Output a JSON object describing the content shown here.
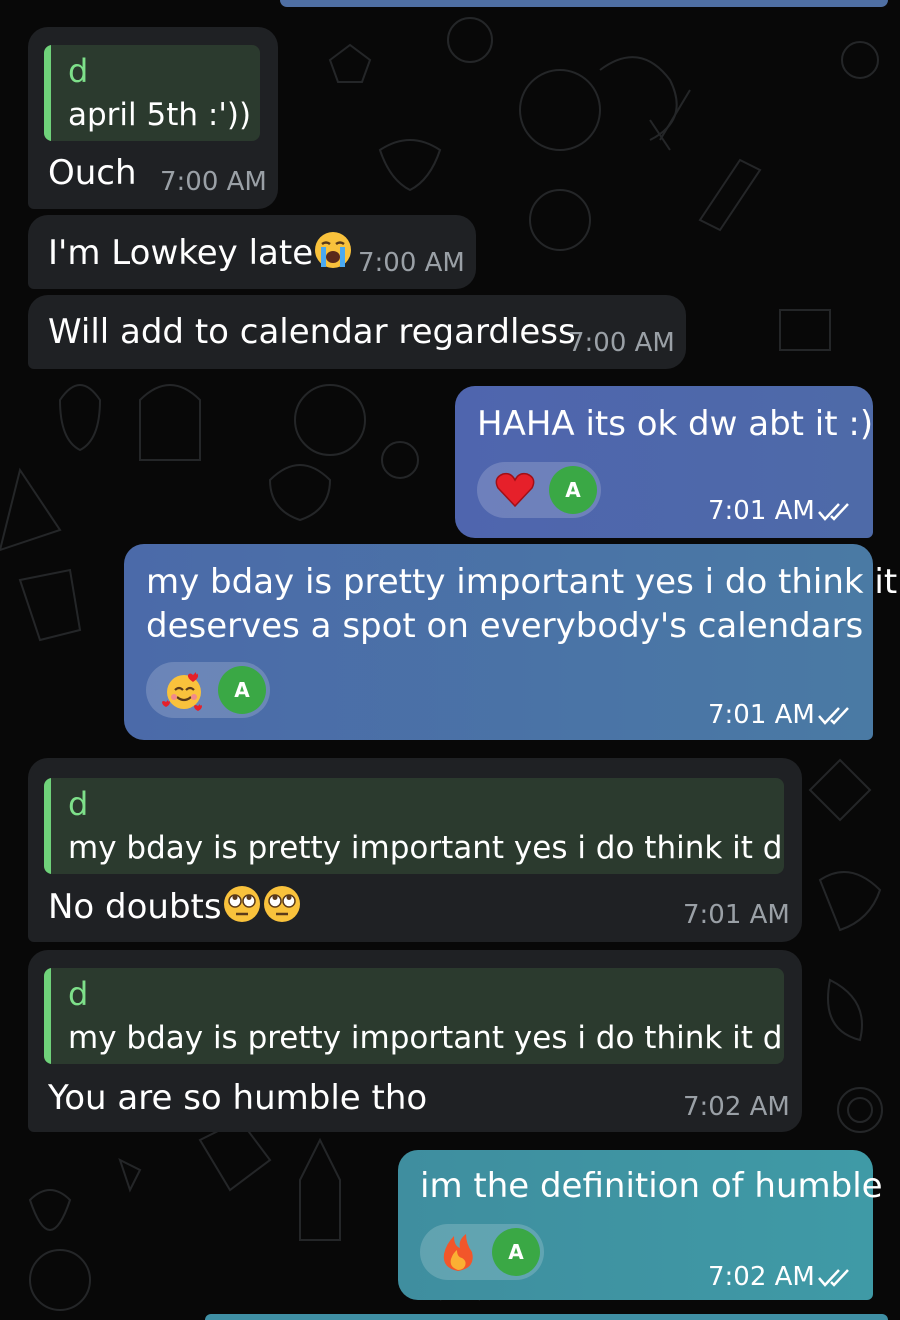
{
  "messages": [
    {
      "reply_author": "d",
      "reply_text": "april 5th :'))",
      "text": "Ouch",
      "time": "7:00 AM"
    },
    {
      "text": "I'm Lowkey late",
      "emoji": "loudly-crying-face",
      "time": "7:00 AM"
    },
    {
      "text": "Will add to calendar regardless",
      "time": "7:00 AM"
    },
    {
      "text": "HAHA its ok dw abt it :)",
      "reaction": "red-heart",
      "reaction_avatar": "A",
      "time": "7:01 AM"
    },
    {
      "line1": "my bday is pretty important yes i do think it",
      "line2": "deserves a spot on everybody's calendars",
      "reaction": "smiling-face-with-hearts",
      "reaction_avatar": "A",
      "time": "7:01 AM"
    },
    {
      "reply_author": "d",
      "reply_text": "my bday is pretty important yes i do think it de...",
      "text": "No doubts",
      "emoji": "face-with-rolling-eyes",
      "time": "7:01 AM"
    },
    {
      "reply_author": "d",
      "reply_text": "my bday is pretty important yes i do think it de...",
      "text": "You are so humble tho",
      "time": "7:02 AM"
    },
    {
      "text": "im the definition of humble",
      "reaction": "fire",
      "reaction_avatar": "A",
      "time": "7:02 AM"
    }
  ],
  "colors": {
    "incoming_bubble": "#1f2124",
    "outgoing_gradient_start": "#5a5fb0",
    "outgoing_gradient_end": "#3d8f9e",
    "reply_accent": "#6fd27a",
    "avatar": "#3aa845"
  }
}
